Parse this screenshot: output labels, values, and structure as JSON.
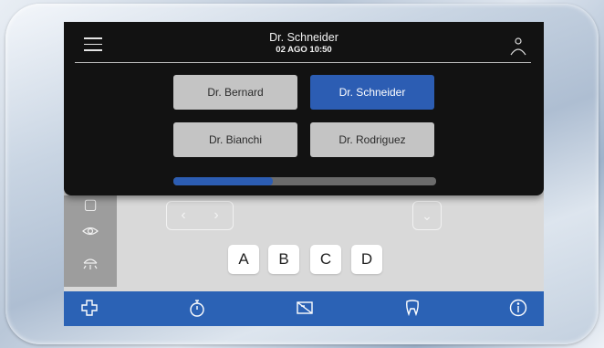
{
  "header": {
    "title": "Dr. Schneider",
    "datetime": "02 AGO 10:50"
  },
  "doctors": [
    {
      "label": "Dr. Bernard",
      "active": false
    },
    {
      "label": "Dr. Schneider",
      "active": true
    },
    {
      "label": "Dr. Bianchi",
      "active": false
    },
    {
      "label": "Dr. Rodriguez",
      "active": false
    }
  ],
  "progress": 0.38,
  "letters": [
    "A",
    "B",
    "C",
    "D"
  ],
  "bottom_bar": {
    "icons": [
      "plus-icon",
      "timer-icon",
      "image-icon",
      "tooth-icon",
      "info-icon"
    ]
  },
  "colors": {
    "accent": "#2c5db3",
    "overlay": "#121212",
    "inactive_button": "#c4c4c4"
  }
}
